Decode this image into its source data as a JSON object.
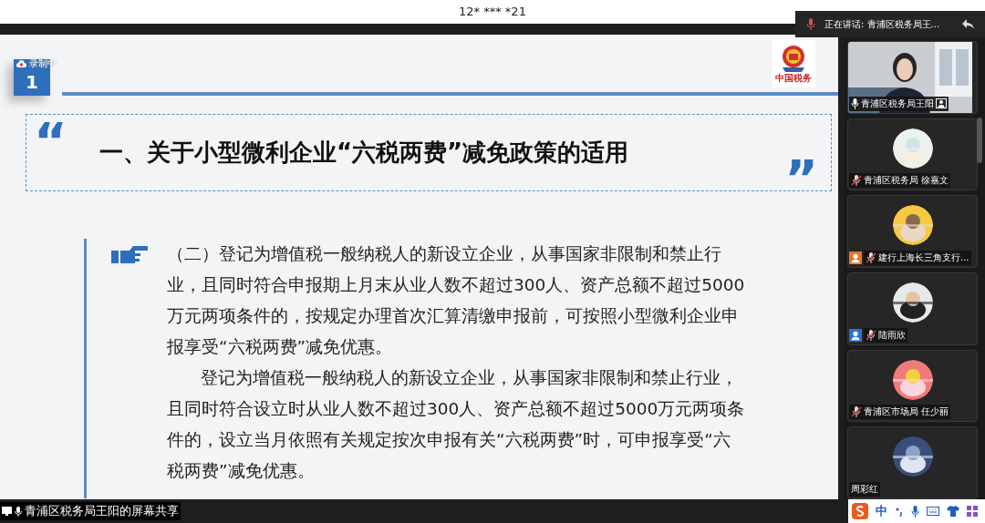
{
  "window": {
    "title": "12* *** *21"
  },
  "speaking": {
    "text": "正在讲话: 青浦区税务局王..."
  },
  "slide": {
    "recording": "录制中",
    "number": "1",
    "logo_text": "中国税务",
    "open_quote": "“",
    "close_quote": "”",
    "title": "一、关于小型微利企业“六税两费”减免政策的适用",
    "paragraphs": [
      {
        "text": "（二）登记为增值税一般纳税人的新设立企业，从事国家非限制和禁止行业，且同时符合申报期上月末从业人数不超过300人、资产总额不超过5000万元两项条件的，按规定办理首次汇算清缴申报前，可按照小型微利企业申报享受“六税两费”减免优惠。",
        "indent": false
      },
      {
        "text": "登记为增值税一般纳税人的新设立企业，从事国家非限制和禁止行业，且同时符合设立时从业人数不超过300人、资产总额不超过5000万元两项条件的，设立当月依照有关规定按次申报有关“六税两费”时，可申报享受“六税两费”减免优惠。",
        "indent": true
      }
    ]
  },
  "participants": [
    {
      "name": "青浦区税务局王阳",
      "kind": "video",
      "muted": false
    },
    {
      "name": "青浦区税务局 徐嘉文",
      "kind": "avatar",
      "muted": true
    },
    {
      "name": "建行上海长三角支行...",
      "kind": "avatar",
      "muted": true,
      "color": "#e8742c"
    },
    {
      "name": "陆雨欣",
      "kind": "avatar",
      "muted": true,
      "color": "#2f6fd6"
    },
    {
      "name": "青浦区市场局 任少丽",
      "kind": "avatar",
      "muted": true
    },
    {
      "name": "周彩红",
      "kind": "avatar"
    }
  ],
  "status_bar": {
    "text": "青浦区税务局王阳的屏幕共享",
    "ime": "中"
  }
}
